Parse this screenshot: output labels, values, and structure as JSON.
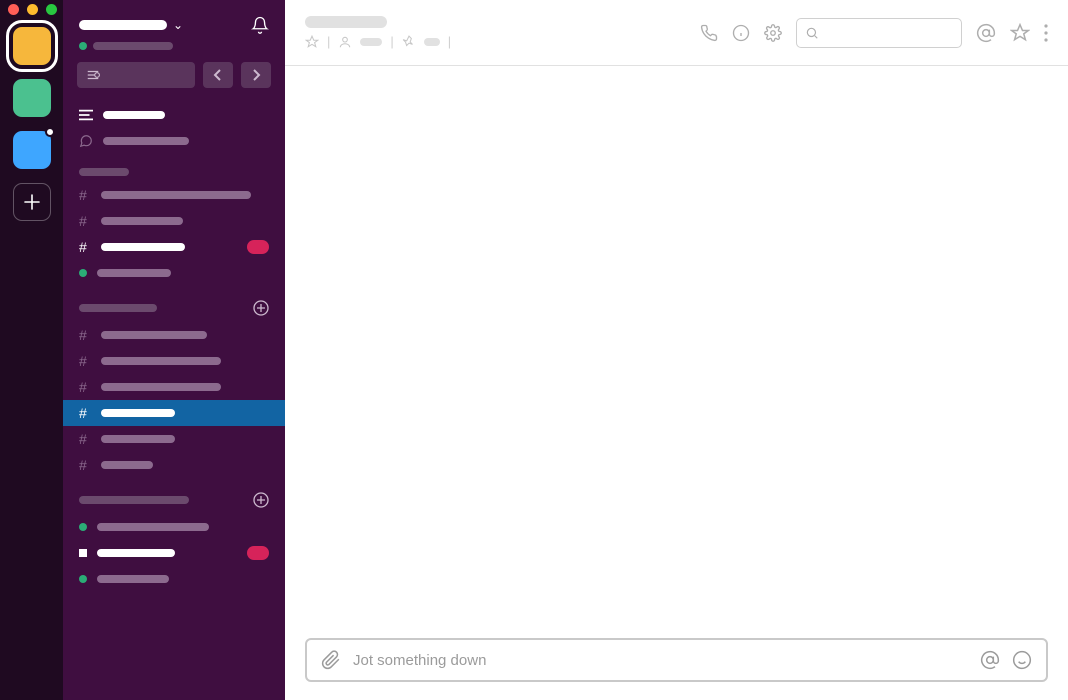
{
  "workspaces": [
    {
      "color": "#f6b73c",
      "active": true,
      "has_dot": false
    },
    {
      "color": "#4bc18f",
      "active": false,
      "has_dot": false
    },
    {
      "color": "#3ea6ff",
      "active": false,
      "has_dot": true
    }
  ],
  "composer": {
    "placeholder": "Jot something down"
  },
  "colors": {
    "sidebar_bg": "#3f0e40",
    "rail_bg": "#1f0a21",
    "active_item": "#1264a3",
    "badge": "#d6235a"
  }
}
